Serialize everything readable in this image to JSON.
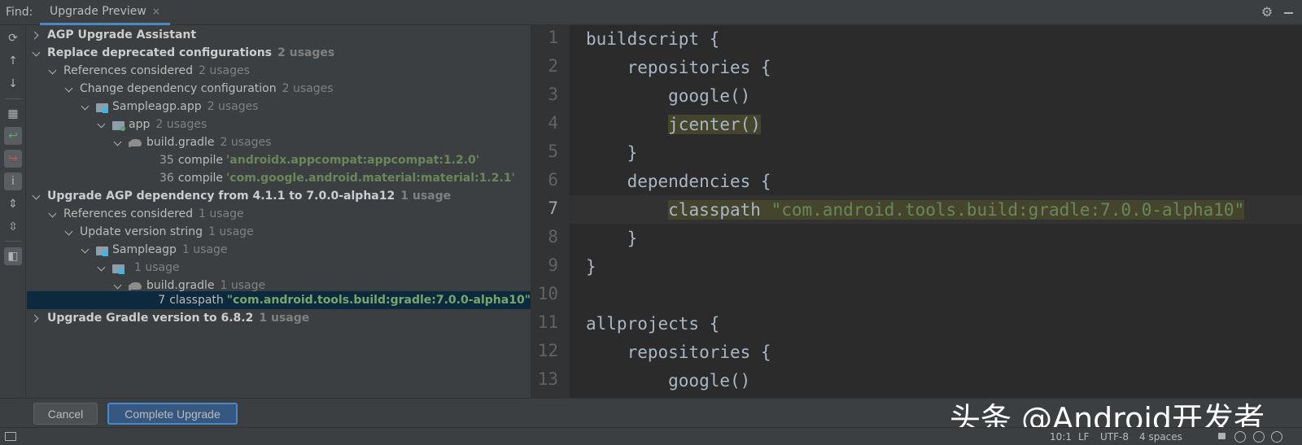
{
  "header": {
    "find_label": "Find:",
    "tab_label": "Upgrade Preview",
    "tab_close": "×"
  },
  "tree": {
    "rows": [
      {
        "text": "AGP Upgrade Assistant",
        "usage": ""
      },
      {
        "text": "Replace deprecated configurations",
        "usage": "2 usages"
      },
      {
        "text": "References considered",
        "usage": "2 usages"
      },
      {
        "text": "Change dependency configuration",
        "usage": "2 usages"
      },
      {
        "text": "Sampleagp.app",
        "usage": "2 usages"
      },
      {
        "text": "app",
        "usage": "2 usages"
      },
      {
        "text": "build.gradle",
        "usage": "2 usages"
      },
      {
        "line": "35",
        "code": "compile",
        "string": "'androidx.appcompat:appcompat:1.2.0'"
      },
      {
        "line": "36",
        "code": "compile",
        "string": "'com.google.android.material:material:1.2.1'"
      },
      {
        "text": "Upgrade AGP dependency from 4.1.1 to 7.0.0-alpha12",
        "usage": "1 usage"
      },
      {
        "text": "References considered",
        "usage": "1 usage"
      },
      {
        "text": "Update version string",
        "usage": "1 usage"
      },
      {
        "text": "Sampleagp",
        "usage": "1 usage"
      },
      {
        "text": "",
        "usage": "1 usage"
      },
      {
        "text": "build.gradle",
        "usage": "1 usage"
      },
      {
        "line": "7",
        "code": "classpath",
        "string": "\"com.android.tools.build:gradle:7.0.0-alpha10\""
      },
      {
        "text": "Upgrade Gradle version to 6.8.2",
        "usage": "1 usage"
      }
    ]
  },
  "editor": {
    "line_numbers": [
      "1",
      "2",
      "3",
      "4",
      "5",
      "6",
      "7",
      "8",
      "9",
      "10",
      "11",
      "12",
      "13"
    ],
    "lines": [
      {
        "a": "buildscript {"
      },
      {
        "a": "    repositories {"
      },
      {
        "a": "        google()"
      },
      {
        "a": "        ",
        "hl": "jcenter()"
      },
      {
        "a": "    }"
      },
      {
        "a": "    dependencies {"
      },
      {
        "a": "        ",
        "hl": "classpath ",
        "str": "\"com.android.tools.build:gradle:7.0.0-alpha10\""
      },
      {
        "a": "    }"
      },
      {
        "a": "}"
      },
      {
        "a": ""
      },
      {
        "a": "allprojects {"
      },
      {
        "a": "    repositories {"
      },
      {
        "a": "        google()"
      }
    ]
  },
  "buttons": {
    "cancel": "Cancel",
    "complete": "Complete Upgrade"
  },
  "watermark": "头条 @Android开发者",
  "status": {
    "position": "10:1",
    "line_sep": "LF",
    "encoding": "UTF-8",
    "indent": "4 spaces"
  },
  "colors": {
    "accent": "#4a88c7",
    "selection": "#0d293e",
    "string": "#6a8759",
    "highlight": "#45442d"
  }
}
